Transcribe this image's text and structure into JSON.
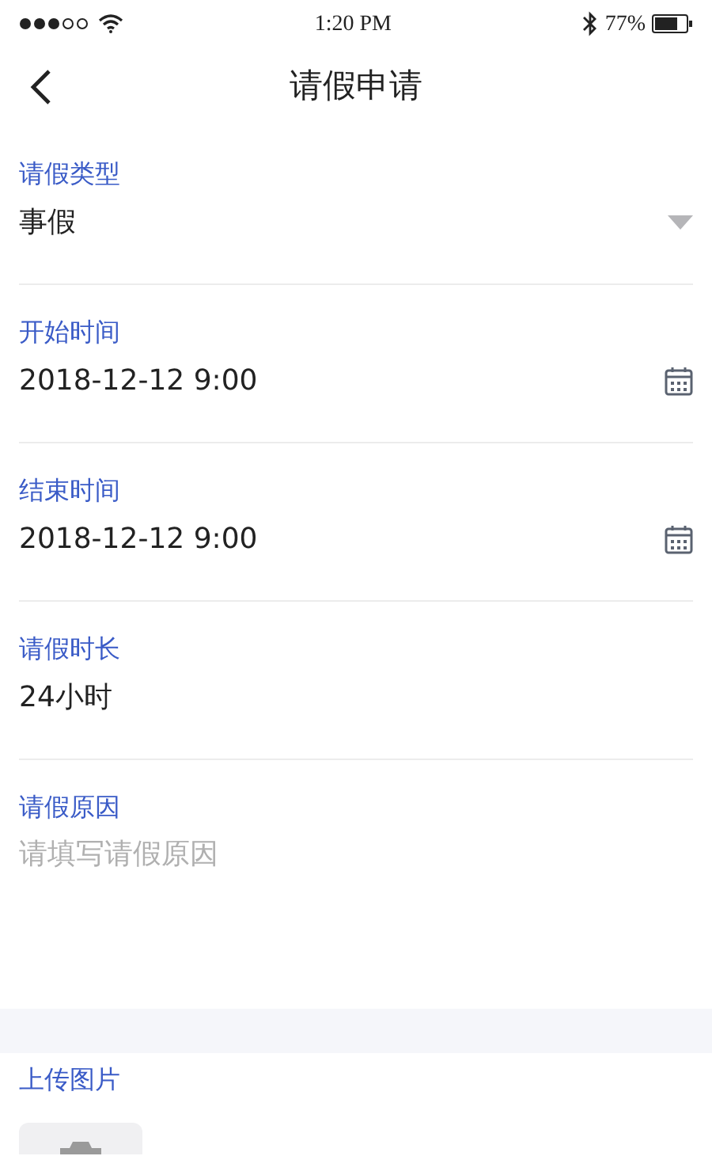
{
  "status_bar": {
    "time": "1:20 PM",
    "battery": "77%"
  },
  "nav": {
    "title": "请假申请"
  },
  "fields": [
    {
      "kind": "select",
      "label": "请假类型",
      "value": "事假"
    },
    {
      "kind": "date",
      "label": "开始时间",
      "value": "2018-12-12 9:00"
    },
    {
      "kind": "date",
      "label": "结束时间",
      "value": "2018-12-12 9:00"
    },
    {
      "kind": "text",
      "label": "请假时长",
      "value": "24小时"
    },
    {
      "kind": "textarea",
      "label": "请假原因",
      "placeholder": "请填写请假原因"
    }
  ],
  "upload": {
    "label": "上传图片"
  }
}
